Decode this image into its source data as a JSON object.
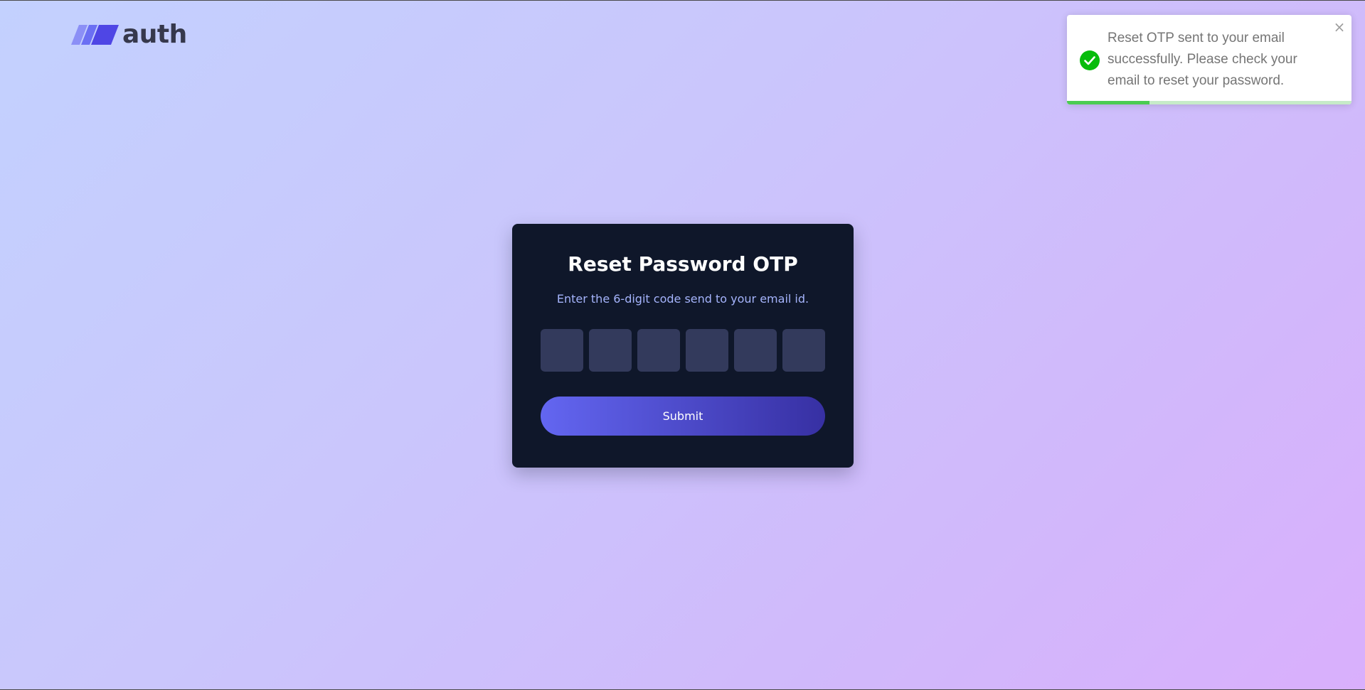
{
  "logo": {
    "text": "auth",
    "colors": [
      "#8b8ff6",
      "#6b6ff3",
      "#4f46e5"
    ]
  },
  "card": {
    "title": "Reset Password OTP",
    "subtitle": "Enter the 6-digit code send to your email id.",
    "otp_digits": [
      "",
      "",
      "",
      "",
      "",
      ""
    ],
    "submit_label": "Submit"
  },
  "toast": {
    "message": "Reset OTP sent to your email successfully. Please check your email to reset your password.",
    "close_symbol": "×",
    "icon": "check-circle-icon",
    "type": "success",
    "progress": 0.29,
    "accent_color": "#07bc0c"
  }
}
